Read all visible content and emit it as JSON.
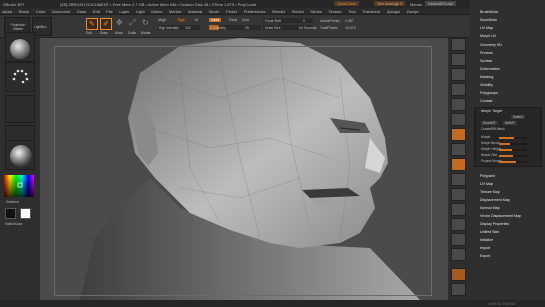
{
  "app": {
    "title": "ZBrush 4R7",
    "titlebar_text": "[ZB] ZBRUSH DOCUMENT  •  Free Mem 2.7 GB  •  Active Mem 545  •  Scratch Disk 48  •  ZTime 1.875  •  PolyCount",
    "quicksave": "QuickSave",
    "see_through": "See-through 0",
    "menus_label": "Menus",
    "default_script": "DefaultZScript"
  },
  "menubar": {
    "items": [
      "Alpha",
      "Brush",
      "Color",
      "Document",
      "Draw",
      "Edit",
      "File",
      "Layer",
      "Light",
      "Macro",
      "Marker",
      "Material",
      "Movie",
      "Picker",
      "Preferences",
      "Render",
      "Stencil",
      "Stroke",
      "Texture",
      "Tool",
      "Transform",
      "Zplugin",
      "Zscript"
    ]
  },
  "toolbar": {
    "projection_master": "Projection Master",
    "lightbox": "LightBox",
    "buttons": [
      "Edit",
      "Draw",
      "Move",
      "Scale",
      "Rotate"
    ],
    "mrgb": "Mrgb",
    "rgb": "Rgb",
    "m": "M",
    "zadd": "Zadd",
    "zsub": "Zsub",
    "zcut": "Zcut",
    "rgb_intensity_label": "Rgb Intensity",
    "rgb_intensity": "100",
    "z_intensity_label": "Z Intensity",
    "z_intensity": "25",
    "focal_shift_label": "Focal Shift",
    "focal_shift": "0",
    "draw_size_label": "Draw Size",
    "draw_size": "64",
    "dynamic": "Dynamic",
    "active_points_label": "ActivePoints:",
    "active_points": "2,087",
    "total_points_label": "TotalPoints:",
    "total_points": "19,079"
  },
  "left_tray": {
    "gradient_label": "Gradient",
    "switch_color_label": "SwitchColor"
  },
  "right_panel": {
    "top_items": [
      "BrushMods",
      "SaveMods",
      "UV Map",
      "Morph UV",
      "Geometry HD",
      "Preview",
      "Surface",
      "Deformation",
      "Masking",
      "Visibility",
      "Polygroups",
      "Contact"
    ],
    "morph_target": "Morph Target",
    "switch": "Switch",
    "store_mt": "StoreMT",
    "delete_mt": "DelMT",
    "create_diff_mesh": "CreateDiff Mesh",
    "sliders": [
      {
        "label": "Morph",
        "value": 0.55
      },
      {
        "label": "Morph Brush",
        "value": 0.4
      },
      {
        "label": "Morph Height",
        "value": 0.45
      },
      {
        "label": "Morph Dist",
        "value": 0.5
      },
      {
        "label": "Project Morph",
        "value": 0.6
      }
    ],
    "bottom_items": [
      "Polypaint",
      "UV Map",
      "Texture Map",
      "Displacement Map",
      "Normal Map",
      "Vector Displacement Map",
      "Display Properties",
      "Unified Skin",
      "Initialize",
      "Import",
      "Export"
    ]
  },
  "status": {
    "watermark": "UNREAL ENGINE"
  },
  "colors": {
    "accent": "#f08a2a",
    "panel": "#2f2f2f",
    "canvas": "#4b4b4b"
  }
}
